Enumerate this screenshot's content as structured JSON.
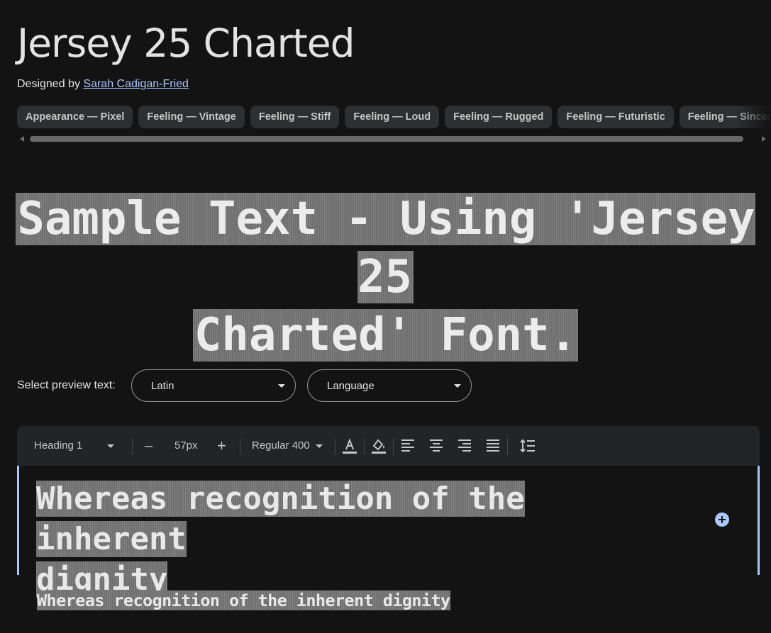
{
  "font_title": "Jersey 25 Charted",
  "designer": {
    "prefix": "Designed by",
    "name": "Sarah Cadigan-Fried"
  },
  "tags": [
    "Appearance — Pixel",
    "Feeling — Vintage",
    "Feeling — Stiff",
    "Feeling — Loud",
    "Feeling — Rugged",
    "Feeling — Futuristic",
    "Feeling — Sincere"
  ],
  "hero_sample": {
    "line1": "Sample Text - Using 'Jersey 25",
    "line2": "Charted' Font."
  },
  "preview_controls": {
    "label": "Select preview text:",
    "script_select": "Latin",
    "language_select": "Language"
  },
  "toolbar": {
    "style_select": "Heading 1",
    "decrease": "–",
    "size": "57px",
    "increase": "+",
    "weight_select": "Regular 400",
    "icons": [
      "text-color-icon",
      "highlight-color-icon",
      "align-left-icon",
      "align-center-icon",
      "align-right-icon",
      "align-justify-icon",
      "line-height-icon"
    ]
  },
  "editor": {
    "heading_line1": "Whereas recognition of the inherent",
    "heading_line2": "dignity",
    "body_text": "Whereas recognition of the inherent dignity"
  },
  "colors": {
    "background": "#131314",
    "accent": "#a8c7fa",
    "chip": "#2e2f30",
    "toolbar": "#232425"
  }
}
